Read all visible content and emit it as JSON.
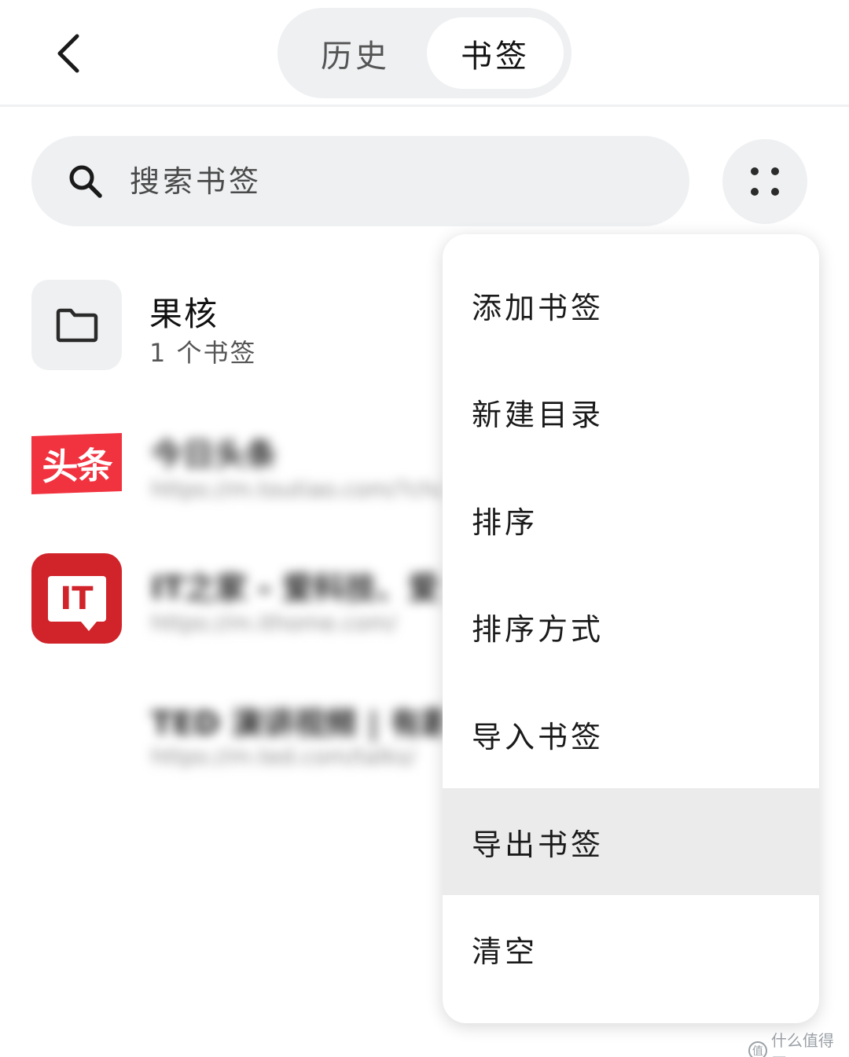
{
  "header": {
    "tabs": [
      {
        "label": "历史",
        "selected": false
      },
      {
        "label": "书签",
        "selected": true
      }
    ],
    "back_icon": "chevron-left-icon"
  },
  "search": {
    "placeholder": "搜索书签",
    "icon": "search-icon",
    "more_icon": "four-dots-icon"
  },
  "bookmarks": {
    "folder": {
      "title": "果核",
      "count_label": "1 个书签"
    },
    "items": [
      {
        "logo_text": "头条",
        "logo_color": "#f1323f",
        "title": "今日头条",
        "url": "https://m.toutiao.com/?channel"
      },
      {
        "logo_text": "IT",
        "logo_color": "#d0232a",
        "title": "IT之家 - 爱科技、爱生活",
        "url": "https://m.ithome.com/"
      },
      {
        "title": "TED 演讲视频 | 有趣的",
        "url": "https://m.ted.com/talks/"
      }
    ]
  },
  "menu": {
    "items": [
      {
        "label": "添加书签",
        "highlighted": false
      },
      {
        "label": "新建目录",
        "highlighted": false
      },
      {
        "label": "排序",
        "highlighted": false
      },
      {
        "label": "排序方式",
        "highlighted": false
      },
      {
        "label": "导入书签",
        "highlighted": false
      },
      {
        "label": "导出书签",
        "highlighted": true
      },
      {
        "label": "清空",
        "highlighted": false
      }
    ]
  },
  "watermark": {
    "logo_text": "值",
    "text": "什么值得买"
  },
  "colors": {
    "surface": "#eef0f2",
    "menu_highlight": "#ebebeb",
    "toutiao_red": "#f1323f",
    "ithome_red": "#d0232a"
  }
}
